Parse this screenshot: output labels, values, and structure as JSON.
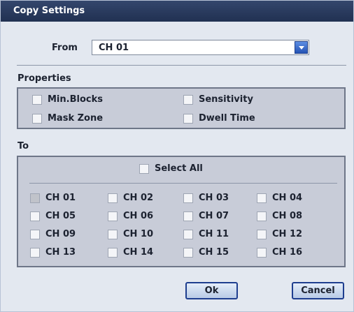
{
  "window": {
    "title": "Copy Settings"
  },
  "from": {
    "label": "From",
    "selected": "CH 01"
  },
  "properties": {
    "label": "Properties",
    "items": [
      {
        "label": "Min.Blocks",
        "checked": false
      },
      {
        "label": "Sensitivity",
        "checked": false
      },
      {
        "label": "Mask Zone",
        "checked": false
      },
      {
        "label": "Dwell Time",
        "checked": false
      }
    ]
  },
  "to": {
    "label": "To",
    "select_all": "Select All",
    "channels": [
      "CH 01",
      "CH 02",
      "CH 03",
      "CH 04",
      "CH 05",
      "CH 06",
      "CH 07",
      "CH 08",
      "CH 09",
      "CH 10",
      "CH 11",
      "CH 12",
      "CH 13",
      "CH 14",
      "CH 15",
      "CH 16"
    ],
    "disabled_channel": "CH 01"
  },
  "buttons": {
    "ok": "Ok",
    "cancel": "Cancel"
  }
}
